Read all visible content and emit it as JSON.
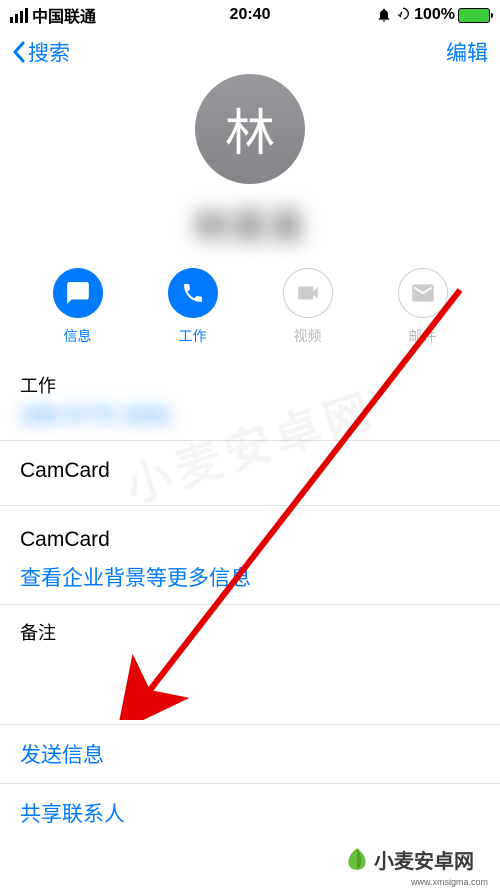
{
  "status": {
    "carrier": "中国联通",
    "time": "20:40",
    "battery": "100%"
  },
  "nav": {
    "back": "搜索",
    "edit": "编辑"
  },
  "contact": {
    "avatar_letter": "林",
    "name": "林某某"
  },
  "actions": {
    "message": "信息",
    "call": "工作",
    "video": "视频",
    "mail": "邮件"
  },
  "rows": {
    "work_label": "工作",
    "work_value": "188 0775 3281",
    "camcard1": "CamCard",
    "camcard2": "CamCard",
    "company_link": "查看企业背景等更多信息",
    "notes_label": "备注",
    "send_message": "发送信息",
    "share_contact": "共享联系人"
  },
  "watermark": {
    "brand": "小麦安卓网",
    "url": "www.xmsigma.com"
  }
}
